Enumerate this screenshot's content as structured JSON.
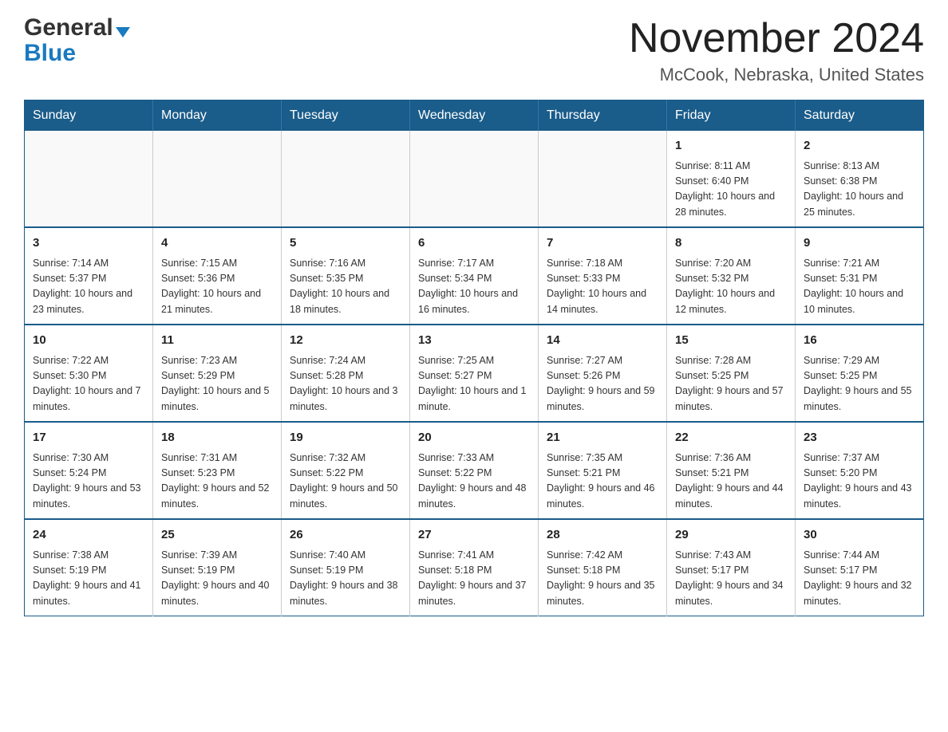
{
  "logo": {
    "general": "General",
    "blue": "Blue"
  },
  "header": {
    "title": "November 2024",
    "subtitle": "McCook, Nebraska, United States"
  },
  "weekdays": [
    "Sunday",
    "Monday",
    "Tuesday",
    "Wednesday",
    "Thursday",
    "Friday",
    "Saturday"
  ],
  "weeks": [
    [
      {
        "day": "",
        "info": ""
      },
      {
        "day": "",
        "info": ""
      },
      {
        "day": "",
        "info": ""
      },
      {
        "day": "",
        "info": ""
      },
      {
        "day": "",
        "info": ""
      },
      {
        "day": "1",
        "info": "Sunrise: 8:11 AM\nSunset: 6:40 PM\nDaylight: 10 hours and 28 minutes."
      },
      {
        "day": "2",
        "info": "Sunrise: 8:13 AM\nSunset: 6:38 PM\nDaylight: 10 hours and 25 minutes."
      }
    ],
    [
      {
        "day": "3",
        "info": "Sunrise: 7:14 AM\nSunset: 5:37 PM\nDaylight: 10 hours and 23 minutes."
      },
      {
        "day": "4",
        "info": "Sunrise: 7:15 AM\nSunset: 5:36 PM\nDaylight: 10 hours and 21 minutes."
      },
      {
        "day": "5",
        "info": "Sunrise: 7:16 AM\nSunset: 5:35 PM\nDaylight: 10 hours and 18 minutes."
      },
      {
        "day": "6",
        "info": "Sunrise: 7:17 AM\nSunset: 5:34 PM\nDaylight: 10 hours and 16 minutes."
      },
      {
        "day": "7",
        "info": "Sunrise: 7:18 AM\nSunset: 5:33 PM\nDaylight: 10 hours and 14 minutes."
      },
      {
        "day": "8",
        "info": "Sunrise: 7:20 AM\nSunset: 5:32 PM\nDaylight: 10 hours and 12 minutes."
      },
      {
        "day": "9",
        "info": "Sunrise: 7:21 AM\nSunset: 5:31 PM\nDaylight: 10 hours and 10 minutes."
      }
    ],
    [
      {
        "day": "10",
        "info": "Sunrise: 7:22 AM\nSunset: 5:30 PM\nDaylight: 10 hours and 7 minutes."
      },
      {
        "day": "11",
        "info": "Sunrise: 7:23 AM\nSunset: 5:29 PM\nDaylight: 10 hours and 5 minutes."
      },
      {
        "day": "12",
        "info": "Sunrise: 7:24 AM\nSunset: 5:28 PM\nDaylight: 10 hours and 3 minutes."
      },
      {
        "day": "13",
        "info": "Sunrise: 7:25 AM\nSunset: 5:27 PM\nDaylight: 10 hours and 1 minute."
      },
      {
        "day": "14",
        "info": "Sunrise: 7:27 AM\nSunset: 5:26 PM\nDaylight: 9 hours and 59 minutes."
      },
      {
        "day": "15",
        "info": "Sunrise: 7:28 AM\nSunset: 5:25 PM\nDaylight: 9 hours and 57 minutes."
      },
      {
        "day": "16",
        "info": "Sunrise: 7:29 AM\nSunset: 5:25 PM\nDaylight: 9 hours and 55 minutes."
      }
    ],
    [
      {
        "day": "17",
        "info": "Sunrise: 7:30 AM\nSunset: 5:24 PM\nDaylight: 9 hours and 53 minutes."
      },
      {
        "day": "18",
        "info": "Sunrise: 7:31 AM\nSunset: 5:23 PM\nDaylight: 9 hours and 52 minutes."
      },
      {
        "day": "19",
        "info": "Sunrise: 7:32 AM\nSunset: 5:22 PM\nDaylight: 9 hours and 50 minutes."
      },
      {
        "day": "20",
        "info": "Sunrise: 7:33 AM\nSunset: 5:22 PM\nDaylight: 9 hours and 48 minutes."
      },
      {
        "day": "21",
        "info": "Sunrise: 7:35 AM\nSunset: 5:21 PM\nDaylight: 9 hours and 46 minutes."
      },
      {
        "day": "22",
        "info": "Sunrise: 7:36 AM\nSunset: 5:21 PM\nDaylight: 9 hours and 44 minutes."
      },
      {
        "day": "23",
        "info": "Sunrise: 7:37 AM\nSunset: 5:20 PM\nDaylight: 9 hours and 43 minutes."
      }
    ],
    [
      {
        "day": "24",
        "info": "Sunrise: 7:38 AM\nSunset: 5:19 PM\nDaylight: 9 hours and 41 minutes."
      },
      {
        "day": "25",
        "info": "Sunrise: 7:39 AM\nSunset: 5:19 PM\nDaylight: 9 hours and 40 minutes."
      },
      {
        "day": "26",
        "info": "Sunrise: 7:40 AM\nSunset: 5:19 PM\nDaylight: 9 hours and 38 minutes."
      },
      {
        "day": "27",
        "info": "Sunrise: 7:41 AM\nSunset: 5:18 PM\nDaylight: 9 hours and 37 minutes."
      },
      {
        "day": "28",
        "info": "Sunrise: 7:42 AM\nSunset: 5:18 PM\nDaylight: 9 hours and 35 minutes."
      },
      {
        "day": "29",
        "info": "Sunrise: 7:43 AM\nSunset: 5:17 PM\nDaylight: 9 hours and 34 minutes."
      },
      {
        "day": "30",
        "info": "Sunrise: 7:44 AM\nSunset: 5:17 PM\nDaylight: 9 hours and 32 minutes."
      }
    ]
  ]
}
